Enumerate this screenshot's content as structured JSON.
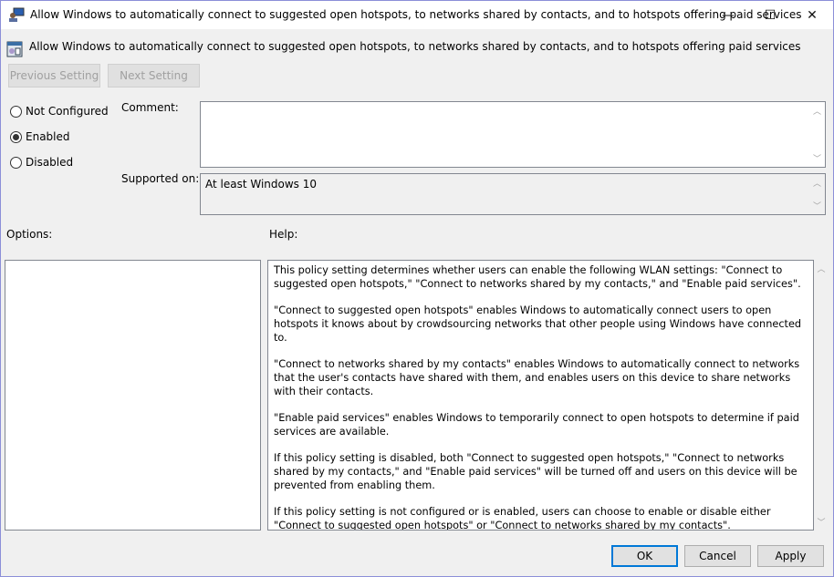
{
  "window": {
    "title": "Allow Windows to automatically connect to suggested open hotspots, to networks shared by contacts, and to hotspots offering paid services",
    "minimize": "—",
    "maximize": "☐",
    "close": "✕"
  },
  "header": {
    "setting_title": "Allow Windows to automatically connect to suggested open hotspots, to networks shared by contacts, and to hotspots offering paid services"
  },
  "nav": {
    "previous": "Previous Setting",
    "next": "Next Setting"
  },
  "state": {
    "options": [
      "Not Configured",
      "Enabled",
      "Disabled"
    ],
    "selected": "Enabled"
  },
  "comment": {
    "label": "Comment:",
    "value": ""
  },
  "supported": {
    "label": "Supported on:",
    "value": "At least Windows 10"
  },
  "options_label": "Options:",
  "help_label": "Help:",
  "help": [
    "This policy setting determines whether users can enable the following WLAN settings: \"Connect to suggested open hotspots,\" \"Connect to networks shared by my contacts,\" and \"Enable paid services\".",
    "\"Connect to suggested open hotspots\" enables Windows to automatically connect users to open hotspots it knows about by crowdsourcing networks that other people using Windows have connected to.",
    "\"Connect to networks shared by my contacts\" enables Windows to automatically connect to networks that the user's contacts have shared with them, and enables users on this device to share networks with their contacts.",
    "\"Enable paid services\" enables Windows to temporarily connect to open hotspots to determine if paid services are available.",
    "If this policy setting is disabled, both \"Connect to suggested open hotspots,\" \"Connect to networks shared by my contacts,\" and \"Enable paid services\" will be turned off and users on this device will be prevented from enabling them.",
    "If this policy setting is not configured or is enabled, users can choose to enable or disable either \"Connect to suggested open hotspots\"  or \"Connect to networks shared by my contacts\"."
  ],
  "buttons": {
    "ok": "OK",
    "cancel": "Cancel",
    "apply": "Apply"
  }
}
